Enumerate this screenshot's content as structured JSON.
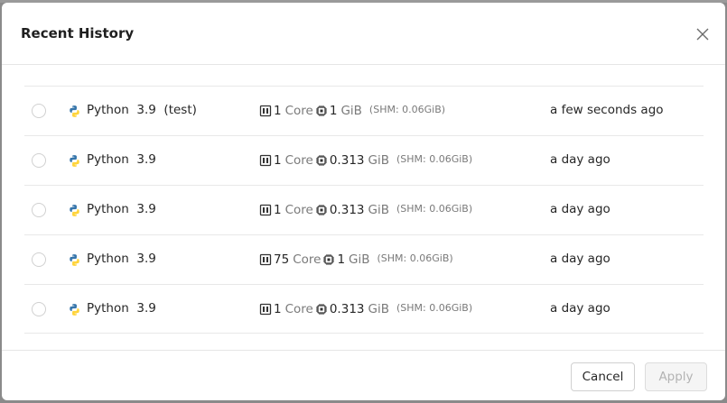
{
  "modal": {
    "title": "Recent History",
    "close_icon": "close-icon"
  },
  "rows": [
    {
      "env": "Python  3.9  (test)",
      "cores": "1",
      "core_unit": "Core",
      "mem": "1",
      "mem_unit": "GiB",
      "shm": "(SHM: 0.06GiB)",
      "time": "a few seconds ago"
    },
    {
      "env": "Python  3.9",
      "cores": "1",
      "core_unit": "Core",
      "mem": "0.313",
      "mem_unit": "GiB",
      "shm": "(SHM: 0.06GiB)",
      "time": "a day ago"
    },
    {
      "env": "Python  3.9",
      "cores": "1",
      "core_unit": "Core",
      "mem": "0.313",
      "mem_unit": "GiB",
      "shm": "(SHM: 0.06GiB)",
      "time": "a day ago"
    },
    {
      "env": "Python  3.9",
      "cores": "75",
      "core_unit": "Core",
      "mem": "1",
      "mem_unit": "GiB",
      "shm": "(SHM: 0.06GiB)",
      "time": "a day ago"
    },
    {
      "env": "Python  3.9",
      "cores": "1",
      "core_unit": "Core",
      "mem": "0.313",
      "mem_unit": "GiB",
      "shm": "(SHM: 0.06GiB)",
      "time": "a day ago"
    }
  ],
  "footer": {
    "cancel_label": "Cancel",
    "apply_label": "Apply"
  },
  "icons": {
    "env": "python-icon",
    "cpu": "cpu-icon",
    "memory": "memory-chip-icon"
  },
  "colors": {
    "python_blue": "#3776ab",
    "python_yellow": "#ffd43b"
  }
}
